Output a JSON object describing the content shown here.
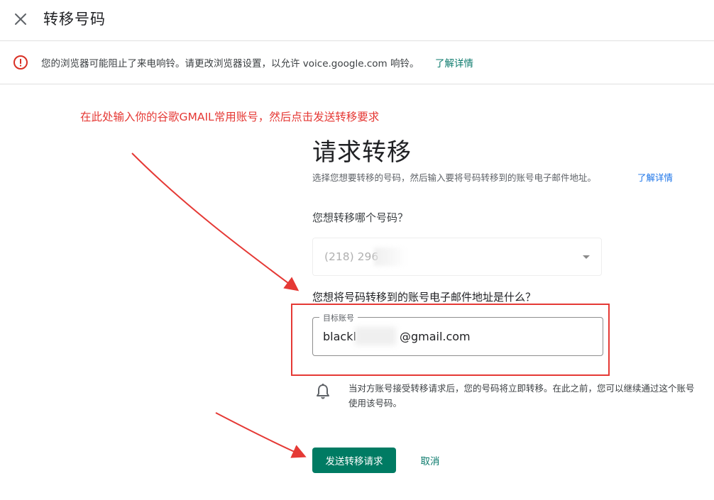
{
  "header": {
    "title": "转移号码"
  },
  "warning": {
    "text": "您的浏览器可能阻止了来电响铃。请更改浏览器设置，以允许 voice.google.com 响铃。",
    "link": "了解详情"
  },
  "annotation": {
    "text": "在此处输入你的谷歌GMAIL常用账号，然后点击发送转移要求",
    "color": "#e53935"
  },
  "main": {
    "title": "请求转移",
    "subtitle": "选择您想要转移的号码，然后输入要将号码转移到的账号电子邮件地址。",
    "subtitle_link": "了解详情",
    "question_number": "您想转移哪个号码？",
    "selected_number": "(218) 296",
    "question_email": "您想将号码转移到的账号电子邮件地址是什么？",
    "email_label": "目标账号",
    "email_value": "blackl            @gmail.com",
    "info": "当对方账号接受转移请求后，您的号码将立即转移。在此之前，您可以继续通过这个账号使用该号码。",
    "send_button": "发送转移请求",
    "cancel_button": "取消"
  },
  "colors": {
    "accent": "#007b63",
    "link_green": "#0b7a6c",
    "link_blue": "#1a73e8",
    "warning_red": "#d93025"
  }
}
